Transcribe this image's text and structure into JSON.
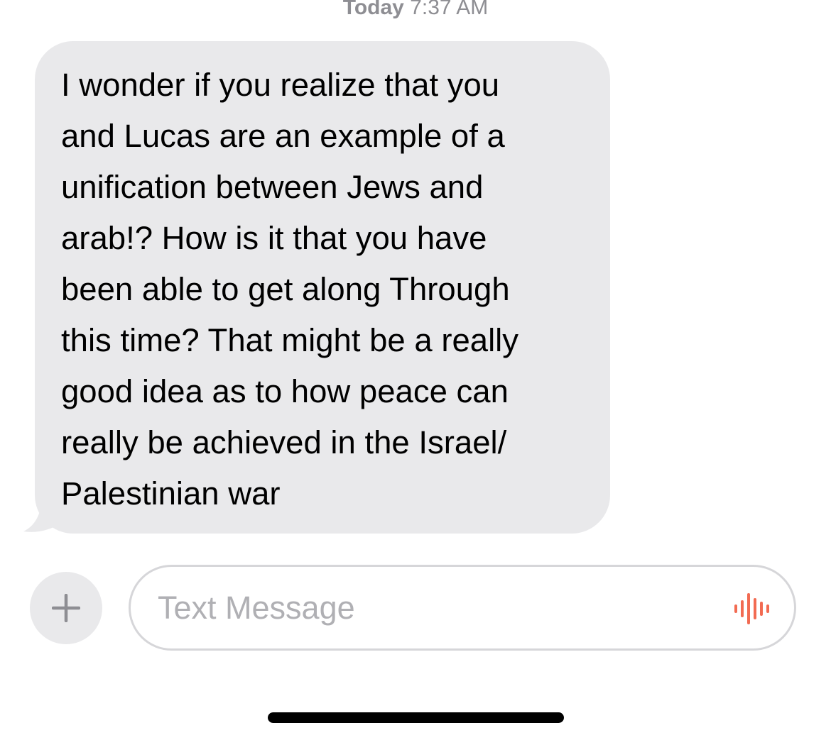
{
  "header": {
    "timestamp_day": "Today",
    "timestamp_time": "7:37 AM"
  },
  "conversation": {
    "messages": [
      {
        "direction": "incoming",
        "text": "I wonder if you realize that you\nand Lucas are an example of a\nunification between Jews and\narab!? How is it that you have\nbeen able to get along Through\nthis time? That might be a really\ngood idea as to how peace can\nreally be achieved in the Israel/\nPalestinian war"
      }
    ]
  },
  "composer": {
    "placeholder": "Text Message",
    "plus_icon": "plus-icon",
    "dictation_icon": "waveform-icon"
  },
  "colors": {
    "incoming_bubble": "#e9e9eb",
    "timestamp": "#8e8e93",
    "placeholder": "#b0b0b4",
    "waveform": "#f26b52",
    "home_indicator": "#000000"
  }
}
